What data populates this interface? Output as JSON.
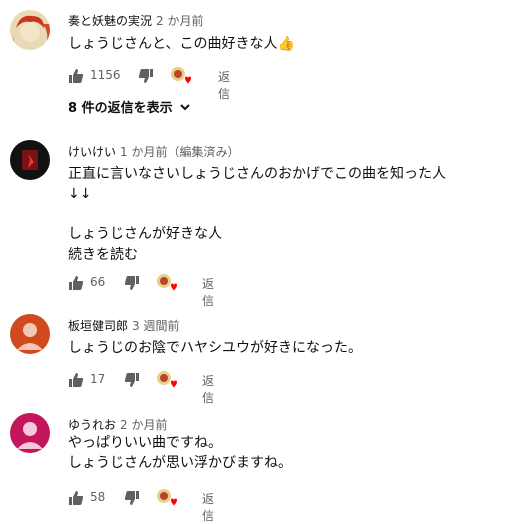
{
  "comments": [
    {
      "author": "奏と妖魅の実況",
      "time": "2 か月前",
      "lines": [
        "しょうじさんと、この曲好きな人👍"
      ],
      "likes": "1156",
      "reply": "返信",
      "show_replies": "8 件の返信を表示",
      "avatar_colors": [
        "#e8d4a8",
        "#c23a2a"
      ]
    },
    {
      "author": "けいけい",
      "time": "1 か月前（編集済み）",
      "lines": [
        "正直に言いなさいしょうじさんのおかげでこの曲を知った人",
        "↓↓",
        "",
        "しょうじさんが好きな人"
      ],
      "read_more": "続きを読む",
      "likes": "66",
      "reply": "返信",
      "avatar_colors": [
        "#111111",
        "#b82020"
      ]
    },
    {
      "author": "板垣健司郎",
      "time": "3 週間前",
      "lines": [
        "しょうじのお陰でハヤシユウが好きになった。"
      ],
      "likes": "17",
      "reply": "返信",
      "avatar_colors": [
        "#d04a1e",
        "#f4c8b8"
      ]
    },
    {
      "author": "ゆうれお",
      "time": "2 か月前",
      "lines": [
        "やっぱりいい曲ですね。",
        "しょうじさんが思い浮かびますね。"
      ],
      "likes": "58",
      "reply": "返信",
      "avatar_colors": [
        "#c2185b",
        "#f8c8d8"
      ]
    }
  ],
  "icons": {
    "like": "thumbs-up-icon",
    "dislike": "thumbs-down-icon",
    "creator_heart": "creator-heart-icon",
    "chevron": "chevron-down-icon"
  },
  "colors": {
    "heart": "#ff0000",
    "secondary_text": "#606060"
  }
}
